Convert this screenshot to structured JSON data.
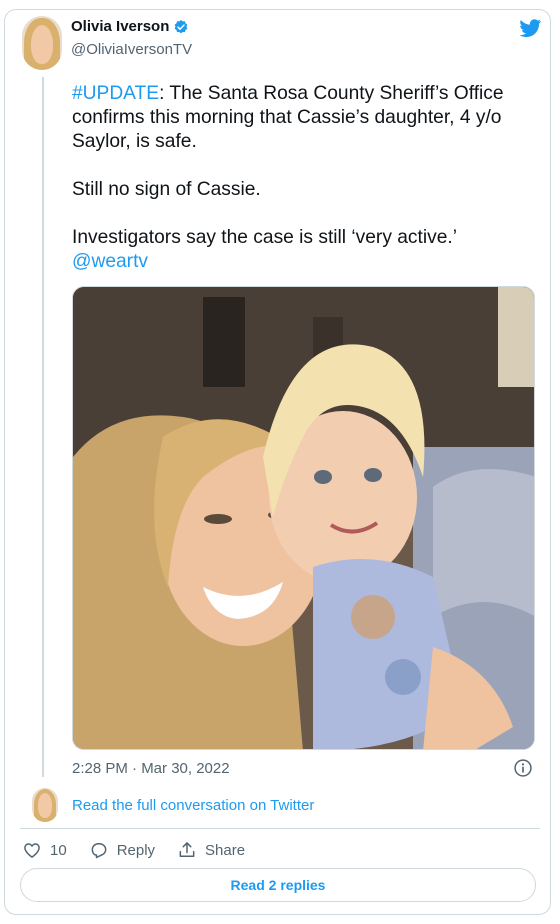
{
  "author": {
    "name": "Olivia Iverson",
    "handle": "@OliviaIversonTV"
  },
  "tweet": {
    "hashtag": "#UPDATE",
    "line1_rest": ": The Santa Rosa County Sheriff’s Office confirms this morning that Cassie’s daughter, 4 y/o Saylor, is safe.",
    "line2": "Still no sign of Cassie.",
    "line3": "Investigators say the case is still ‘very active.’",
    "mention": "@weartv"
  },
  "timestamp": "2:28 PM · Mar 30, 2022",
  "read_conversation": "Read the full conversation on Twitter",
  "actions": {
    "like_count": "10",
    "reply_label": "Reply",
    "share_label": "Share"
  },
  "read_replies_label": "Read 2 replies",
  "colors": {
    "accent": "#1d9bf0",
    "text": "#0f1419",
    "secondary": "#536471",
    "border": "#cfd9de"
  },
  "icons": [
    "verified-badge-icon",
    "twitter-bird-icon",
    "info-icon",
    "heart-icon",
    "reply-icon",
    "share-icon"
  ]
}
